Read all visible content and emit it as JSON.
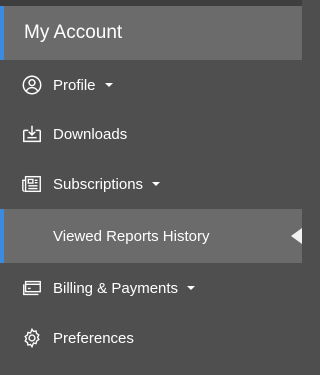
{
  "header": {
    "title": "My Account"
  },
  "menu": {
    "profile": {
      "label": "Profile",
      "icon": "user-circle-icon",
      "has_caret": true
    },
    "downloads": {
      "label": "Downloads",
      "icon": "download-box-icon"
    },
    "subscriptions": {
      "label": "Subscriptions",
      "icon": "newspaper-icon",
      "has_caret": true
    },
    "viewed_reports": {
      "label": "Viewed Reports History",
      "selected": true
    },
    "billing": {
      "label": "Billing & Payments",
      "icon": "credit-card-icon",
      "has_caret": true
    },
    "preferences": {
      "label": "Preferences",
      "icon": "gear-icon"
    }
  },
  "colors": {
    "background": "#4f4f4f",
    "highlight": "#6b6b6b",
    "accent": "#3d8be0",
    "text": "#ffffff"
  }
}
